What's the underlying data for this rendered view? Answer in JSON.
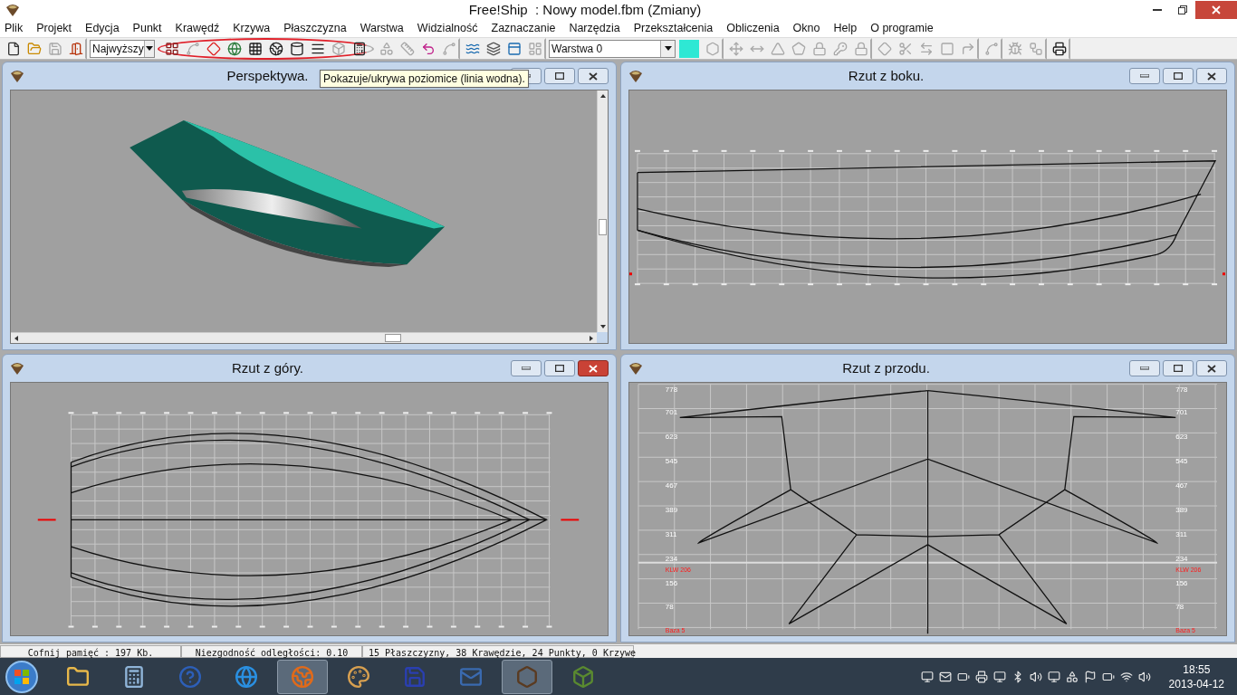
{
  "window": {
    "title": "Free!Ship  : Nowy model.fbm (Zmiany)"
  },
  "menu": [
    "Plik",
    "Projekt",
    "Edycja",
    "Punkt",
    "Krawędź",
    "Krzywa",
    "Płaszczyzna",
    "Warstwa",
    "Widzialność",
    "Zaznaczanie",
    "Narzędzia",
    "Przekształcenia",
    "Obliczenia",
    "Okno",
    "Help",
    "O programie"
  ],
  "toolbar": [
    {
      "kind": "buttons",
      "highlighted": false,
      "buttons": [
        {
          "disabled": false
        },
        {
          "disabled": false
        },
        {
          "disabled": true
        },
        {
          "disabled": false
        }
      ]
    },
    {
      "kind": "dropdown",
      "value": "Najwyższy"
    },
    {
      "kind": "buttons",
      "highlighted": true,
      "buttons": [
        {
          "disabled": false
        },
        {
          "disabled": true
        },
        {
          "disabled": false
        },
        {
          "disabled": false
        },
        {
          "disabled": false
        },
        {
          "disabled": false
        },
        {
          "disabled": false
        },
        {
          "disabled": false
        },
        {
          "disabled": true
        },
        {
          "disabled": false
        }
      ]
    },
    {
      "kind": "buttons",
      "highlighted": false,
      "buttons": [
        {
          "disabled": true
        },
        {
          "disabled": true
        },
        {
          "disabled": false
        },
        {
          "disabled": true
        }
      ]
    },
    {
      "kind": "buttons",
      "highlighted": false,
      "buttons": [
        {
          "disabled": false
        },
        {
          "disabled": false
        },
        {
          "disabled": false
        },
        {
          "disabled": true
        }
      ]
    },
    {
      "kind": "dropdown",
      "value": "Warstwa 0"
    },
    {
      "kind": "swatch",
      "color": "#2ee8d4"
    },
    {
      "kind": "buttons",
      "highlighted": false,
      "buttons": [
        {
          "disabled": true
        }
      ]
    },
    {
      "kind": "buttons",
      "highlighted": false,
      "buttons": [
        {
          "disabled": true
        },
        {
          "disabled": true
        },
        {
          "disabled": true
        },
        {
          "disabled": true
        },
        {
          "disabled": true
        },
        {
          "disabled": true
        },
        {
          "disabled": true
        }
      ]
    },
    {
      "kind": "buttons",
      "highlighted": false,
      "buttons": [
        {
          "disabled": true
        },
        {
          "disabled": true
        },
        {
          "disabled": true
        },
        {
          "disabled": true
        },
        {
          "disabled": true
        }
      ]
    },
    {
      "kind": "buttons",
      "highlighted": false,
      "buttons": [
        {
          "disabled": true
        }
      ]
    },
    {
      "kind": "buttons",
      "highlighted": false,
      "buttons": [
        {
          "disabled": true
        },
        {
          "disabled": true
        }
      ]
    },
    {
      "kind": "buttons",
      "highlighted": false,
      "buttons": [
        {
          "disabled": false
        }
      ]
    }
  ],
  "tooltip": "Pokazuje/ukrywa poziomice (linia wodna).",
  "views": [
    {
      "kind": "perspective",
      "title": "Perspektywa.",
      "active": false
    },
    {
      "kind": "side",
      "title": "Rzut z boku.",
      "active": false
    },
    {
      "kind": "top",
      "title": "Rzut z góry.",
      "active": true
    },
    {
      "kind": "front",
      "title": "Rzut z przodu.",
      "active": false,
      "left_labels": [
        {
          "kind": "height",
          "text": "778"
        },
        {
          "kind": "height",
          "text": "701"
        },
        {
          "kind": "height",
          "text": "623"
        },
        {
          "kind": "height",
          "text": "545"
        },
        {
          "kind": "height",
          "text": "467"
        },
        {
          "kind": "height",
          "text": "389"
        },
        {
          "kind": "height",
          "text": "311"
        },
        {
          "kind": "height",
          "text": "234"
        },
        {
          "kind": "waterline",
          "text": "KLW 206"
        },
        {
          "kind": "height",
          "text": "156"
        },
        {
          "kind": "height",
          "text": "78"
        },
        {
          "kind": "base",
          "text": "Baza 5"
        }
      ],
      "right_labels": [
        {
          "kind": "height",
          "text": "778"
        },
        {
          "kind": "height",
          "text": "701"
        },
        {
          "kind": "height",
          "text": "623"
        },
        {
          "kind": "height",
          "text": "545"
        },
        {
          "kind": "height",
          "text": "467"
        },
        {
          "kind": "height",
          "text": "389"
        },
        {
          "kind": "height",
          "text": "311"
        },
        {
          "kind": "height",
          "text": "234"
        },
        {
          "kind": "waterline",
          "text": "KLW 206"
        },
        {
          "kind": "height",
          "text": "156"
        },
        {
          "kind": "height",
          "text": "78"
        },
        {
          "kind": "base",
          "text": "Baza 5"
        }
      ]
    }
  ],
  "status_bar": [
    "Cofnij pamięć : 197 Kb.",
    "Niezgodność odległości: 0.10",
    "15 Płaszczyzny, 38 Krawędzie, 24 Punkty, 0 Krzywe"
  ],
  "taskbar": {
    "apps": [
      {
        "running": false
      },
      {
        "running": false
      },
      {
        "running": false
      },
      {
        "running": false
      },
      {
        "running": true
      },
      {
        "running": false
      },
      {
        "running": false
      },
      {
        "running": false
      },
      {
        "running": true
      },
      {
        "running": false
      }
    ],
    "time": "18:55",
    "date": "2013-04-12"
  }
}
